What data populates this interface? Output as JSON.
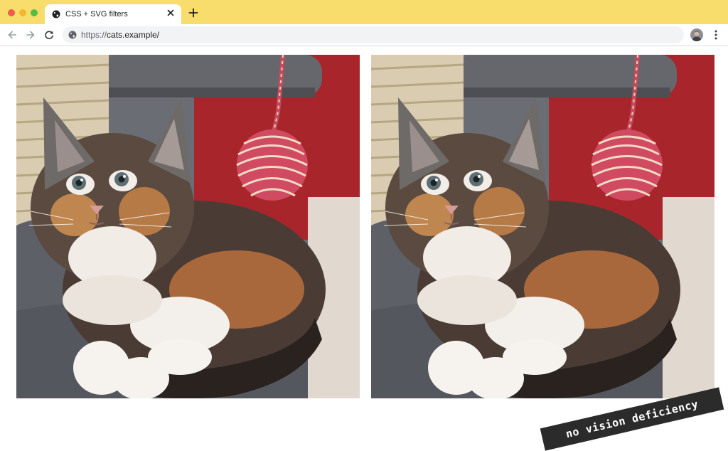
{
  "window": {
    "controls": [
      "close",
      "minimize",
      "maximize"
    ],
    "colors": {
      "tabstrip": "#f8dd6d",
      "close": "#ee5b52",
      "minimize": "#f1b72f",
      "maximize": "#4ec240"
    }
  },
  "tabs": [
    {
      "title": "CSS + SVG filters",
      "icon": "globe-icon",
      "active": true
    }
  ],
  "new_tab_icon": "plus-icon",
  "toolbar": {
    "back_icon": "back-arrow-icon",
    "forward_icon": "forward-arrow-icon",
    "reload_icon": "reload-icon",
    "menu_icon": "kebab-menu-icon"
  },
  "address_bar": {
    "scheme": "https://",
    "host": "cats.example/",
    "site_icon": "globe-icon"
  },
  "content": {
    "images": [
      {
        "subject": "calico kitten with hanging red yarn ball",
        "filter": "none"
      },
      {
        "subject": "calico kitten with hanging red yarn ball",
        "filter": "none"
      }
    ],
    "caption": "no vision deficiency"
  }
}
